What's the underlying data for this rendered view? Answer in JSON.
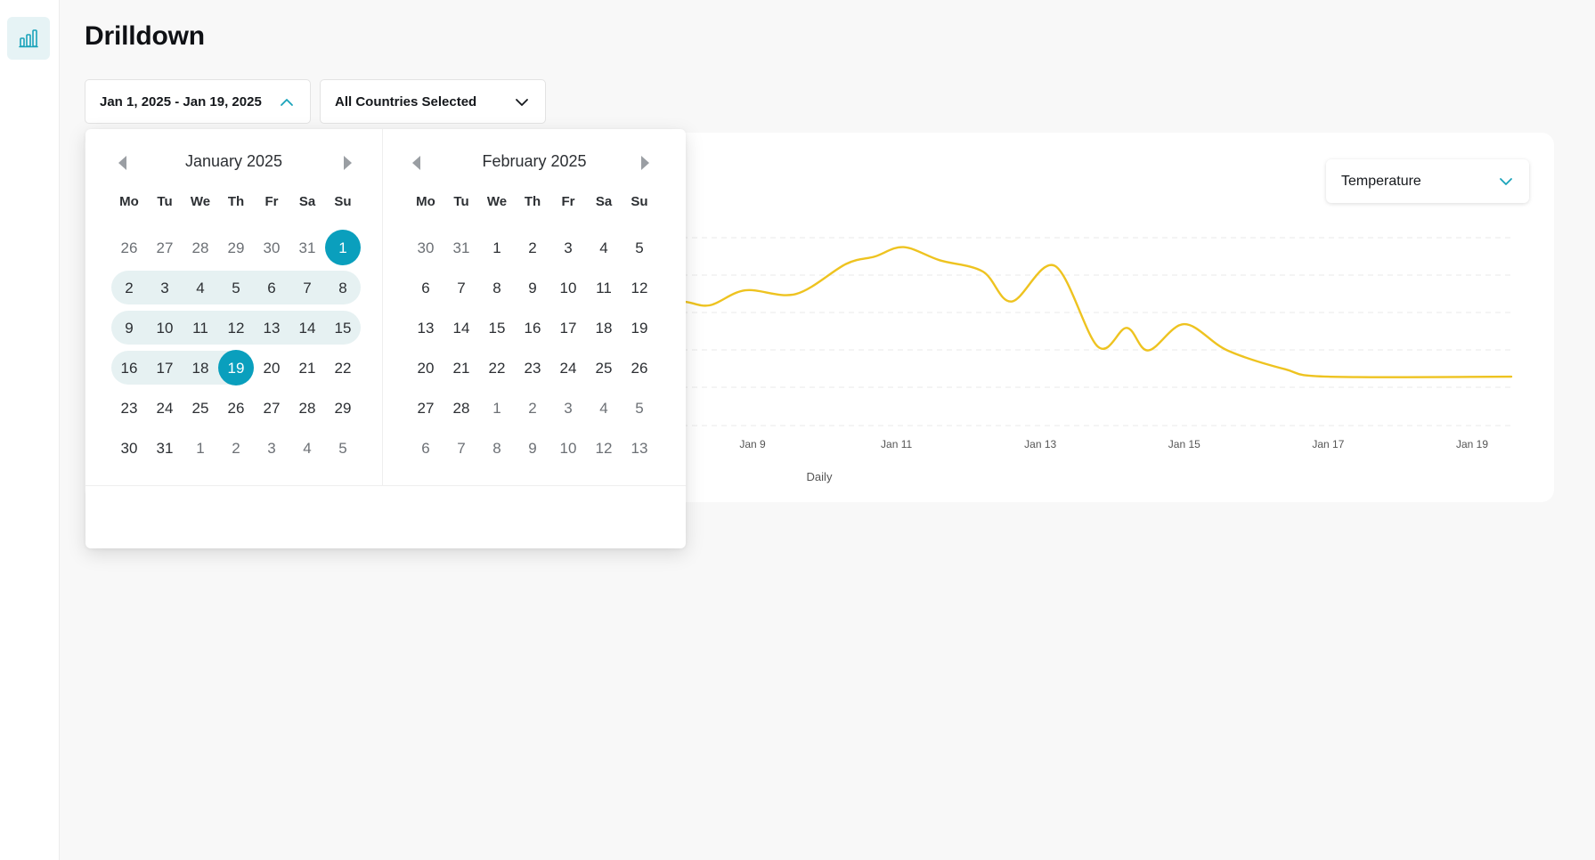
{
  "sidebar": {
    "items": [
      {
        "icon": "bar-chart-icon",
        "active": true
      }
    ]
  },
  "header": {
    "title": "Drilldown"
  },
  "filters": {
    "date_range": "Jan 1, 2025 - Jan 19, 2025",
    "country": "All Countries Selected"
  },
  "metric_select": {
    "value": "Temperature"
  },
  "date_picker": {
    "weekdays": [
      "Mo",
      "Tu",
      "We",
      "Th",
      "Fr",
      "Sa",
      "Su"
    ],
    "months": [
      {
        "title": "January 2025",
        "weeks": [
          [
            "26",
            "27",
            "28",
            "29",
            "30",
            "31",
            "1"
          ],
          [
            "2",
            "3",
            "4",
            "5",
            "6",
            "7",
            "8"
          ],
          [
            "9",
            "10",
            "11",
            "12",
            "13",
            "14",
            "15"
          ],
          [
            "16",
            "17",
            "18",
            "19",
            "20",
            "21",
            "22"
          ],
          [
            "23",
            "24",
            "25",
            "26",
            "27",
            "28",
            "29"
          ],
          [
            "30",
            "31",
            "1",
            "2",
            "3",
            "4",
            "5"
          ]
        ]
      },
      {
        "title": "February 2025",
        "weeks": [
          [
            "30",
            "31",
            "1",
            "2",
            "3",
            "4",
            "5"
          ],
          [
            "6",
            "7",
            "8",
            "9",
            "10",
            "11",
            "12"
          ],
          [
            "13",
            "14",
            "15",
            "16",
            "17",
            "18",
            "19"
          ],
          [
            "20",
            "21",
            "22",
            "23",
            "24",
            "25",
            "26"
          ],
          [
            "27",
            "28",
            "1",
            "2",
            "3",
            "4",
            "5"
          ],
          [
            "6",
            "7",
            "8",
            "9",
            "10",
            "12",
            "13"
          ]
        ]
      }
    ],
    "selected_start": "Jan 1, 2025",
    "selected_end": "Jan 19, 2025"
  },
  "chart_data": {
    "type": "line",
    "xlabel": "Daily",
    "ylabel": "",
    "x_ticks": [
      "Jan 9",
      "Jan 11",
      "Jan 13",
      "Jan 15",
      "Jan 17",
      "Jan 19"
    ],
    "grid": true,
    "series": [
      {
        "color": "#eec320",
        "points": [
          {
            "x": "Jan 7.5",
            "y": 0.62
          },
          {
            "x": "Jan 8",
            "y": 0.66
          },
          {
            "x": "Jan 8.4",
            "y": 0.64
          },
          {
            "x": "Jan 8.9",
            "y": 0.72
          },
          {
            "x": "Jan 9.6",
            "y": 0.7
          },
          {
            "x": "Jan 10.3",
            "y": 0.86
          },
          {
            "x": "Jan 10.7",
            "y": 0.9
          },
          {
            "x": "Jan 11.1",
            "y": 0.95
          },
          {
            "x": "Jan 11.6",
            "y": 0.88
          },
          {
            "x": "Jan 12.2",
            "y": 0.82
          },
          {
            "x": "Jan 12.6",
            "y": 0.66
          },
          {
            "x": "Jan 13.2",
            "y": 0.85
          },
          {
            "x": "Jan 13.8",
            "y": 0.42
          },
          {
            "x": "Jan 14.2",
            "y": 0.52
          },
          {
            "x": "Jan 14.5",
            "y": 0.4
          },
          {
            "x": "Jan 15",
            "y": 0.54
          },
          {
            "x": "Jan 15.6",
            "y": 0.4
          },
          {
            "x": "Jan 16.4",
            "y": 0.3
          },
          {
            "x": "Jan 17",
            "y": 0.26
          },
          {
            "x": "Jan 19.6",
            "y": 0.26
          }
        ]
      }
    ]
  }
}
